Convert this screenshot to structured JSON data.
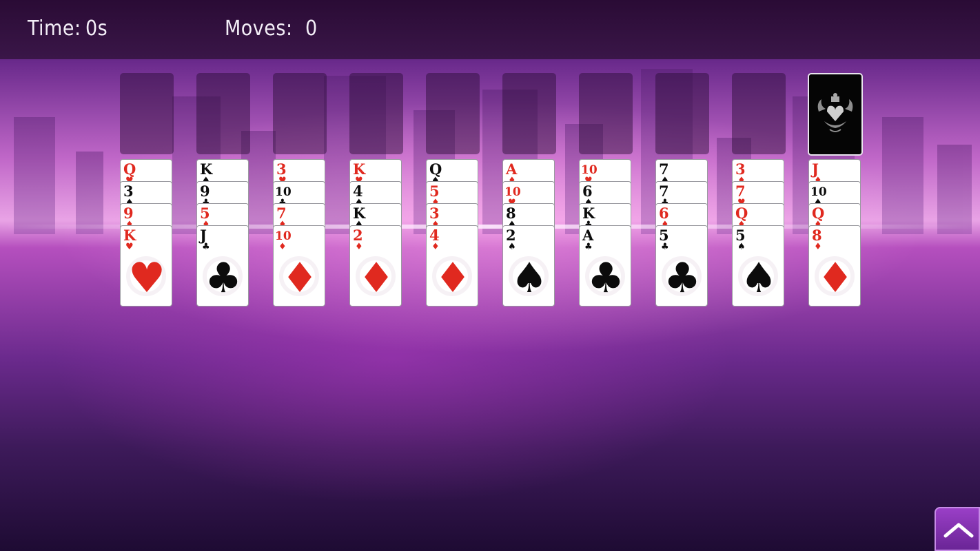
{
  "hud": {
    "time_label": "Time:",
    "time_value": "0s",
    "moves_label": "Moves:",
    "moves_value": "0"
  },
  "colors": {
    "red": "#e0291f",
    "black": "#0c0c0c"
  },
  "stock_icon": "card-back-emblem-icon",
  "scroll_button_icon": "chevron-up-icon",
  "tableau": [
    {
      "cards": [
        {
          "rank": "Q",
          "suit": "♥"
        },
        {
          "rank": "3",
          "suit": "♠"
        },
        {
          "rank": "9",
          "suit": "♦"
        },
        {
          "rank": "K",
          "suit": "♥"
        }
      ]
    },
    {
      "cards": [
        {
          "rank": "K",
          "suit": "♠"
        },
        {
          "rank": "9",
          "suit": "♣"
        },
        {
          "rank": "5",
          "suit": "♦"
        },
        {
          "rank": "J",
          "suit": "♣"
        }
      ]
    },
    {
      "cards": [
        {
          "rank": "3",
          "suit": "♥"
        },
        {
          "rank": "10",
          "suit": "♣"
        },
        {
          "rank": "7",
          "suit": "♦"
        },
        {
          "rank": "10",
          "suit": "♦"
        }
      ]
    },
    {
      "cards": [
        {
          "rank": "K",
          "suit": "♥"
        },
        {
          "rank": "4",
          "suit": "♠"
        },
        {
          "rank": "K",
          "suit": "♠"
        },
        {
          "rank": "2",
          "suit": "♦"
        }
      ]
    },
    {
      "cards": [
        {
          "rank": "Q",
          "suit": "♠"
        },
        {
          "rank": "5",
          "suit": "♦"
        },
        {
          "rank": "3",
          "suit": "♦"
        },
        {
          "rank": "4",
          "suit": "♦"
        }
      ]
    },
    {
      "cards": [
        {
          "rank": "A",
          "suit": "♦"
        },
        {
          "rank": "10",
          "suit": "♥"
        },
        {
          "rank": "8",
          "suit": "♠"
        },
        {
          "rank": "2",
          "suit": "♠"
        }
      ]
    },
    {
      "cards": [
        {
          "rank": "10",
          "suit": "♥"
        },
        {
          "rank": "6",
          "suit": "♠"
        },
        {
          "rank": "K",
          "suit": "♣"
        },
        {
          "rank": "A",
          "suit": "♣"
        }
      ]
    },
    {
      "cards": [
        {
          "rank": "7",
          "suit": "♠"
        },
        {
          "rank": "7",
          "suit": "♣"
        },
        {
          "rank": "6",
          "suit": "♦"
        },
        {
          "rank": "5",
          "suit": "♣"
        }
      ]
    },
    {
      "cards": [
        {
          "rank": "3",
          "suit": "♦"
        },
        {
          "rank": "7",
          "suit": "♥"
        },
        {
          "rank": "Q",
          "suit": "♦"
        },
        {
          "rank": "5",
          "suit": "♠"
        }
      ]
    },
    {
      "cards": [
        {
          "rank": "J",
          "suit": "♦"
        },
        {
          "rank": "10",
          "suit": "♠"
        },
        {
          "rank": "Q",
          "suit": "♦"
        },
        {
          "rank": "8",
          "suit": "♦"
        }
      ]
    }
  ]
}
